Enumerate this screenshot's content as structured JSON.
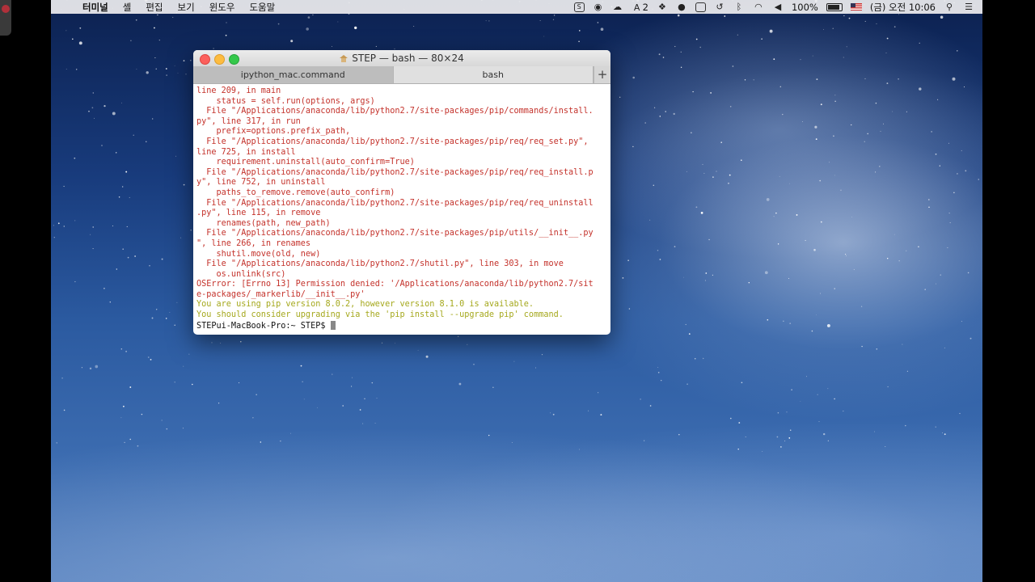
{
  "menubar": {
    "app_name": "터미널",
    "menus": [
      "셸",
      "편집",
      "보기",
      "윈도우",
      "도움말"
    ],
    "status": {
      "adobe_count": "2",
      "battery": "100%",
      "clock": "(금) 오전 10:06"
    }
  },
  "window": {
    "title": "STEP — bash — 80×24",
    "tabs": [
      "ipython_mac.command",
      "bash"
    ],
    "add_tab": "+"
  },
  "terminal": {
    "error_lines": [
      "line 209, in main",
      "    status = self.run(options, args)",
      "  File \"/Applications/anaconda/lib/python2.7/site-packages/pip/commands/install.",
      "py\", line 317, in run",
      "    prefix=options.prefix_path,",
      "  File \"/Applications/anaconda/lib/python2.7/site-packages/pip/req/req_set.py\",",
      "line 725, in install",
      "    requirement.uninstall(auto_confirm=True)",
      "  File \"/Applications/anaconda/lib/python2.7/site-packages/pip/req/req_install.p",
      "y\", line 752, in uninstall",
      "    paths_to_remove.remove(auto_confirm)",
      "  File \"/Applications/anaconda/lib/python2.7/site-packages/pip/req/req_uninstall",
      ".py\", line 115, in remove",
      "    renames(path, new_path)",
      "  File \"/Applications/anaconda/lib/python2.7/site-packages/pip/utils/__init__.py",
      "\", line 266, in renames",
      "    shutil.move(old, new)",
      "  File \"/Applications/anaconda/lib/python2.7/shutil.py\", line 303, in move",
      "    os.unlink(src)",
      "OSError: [Errno 13] Permission denied: '/Applications/anaconda/lib/python2.7/sit",
      "e-packages/_markerlib/__init__.py'"
    ],
    "warning_lines": [
      "You are using pip version 8.0.2, however version 8.1.0 is available.",
      "You should consider upgrading via the 'pip install --upgrade pip' command."
    ],
    "prompt": "STEPui-MacBook-Pro:~ STEP$ "
  },
  "colors": {
    "error": "#c4322b",
    "warning": "#a5a81c",
    "close": "#fc605c",
    "minimize": "#fdbc40",
    "zoom": "#34c84a"
  }
}
